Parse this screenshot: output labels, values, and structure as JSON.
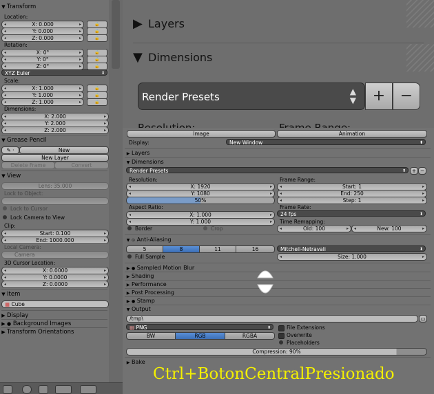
{
  "left_panel": {
    "transform": {
      "title": "Transform",
      "location_label": "Location:",
      "location": [
        "X: 0.000",
        "Y: 0.000",
        "Z: 0.000"
      ],
      "rotation_label": "Rotation:",
      "rotation": [
        "X: 0°",
        "Y: 0°",
        "Z: 0°"
      ],
      "rotation_mode": "XYZ Euler",
      "scale_label": "Scale:",
      "scale": [
        "X: 1.000",
        "Y: 1.000",
        "Z: 1.000"
      ],
      "dimensions_label": "Dimensions:",
      "dimensions": [
        "X: 2.000",
        "Y: 2.000",
        "Z: 2.000"
      ]
    },
    "grease_pencil": {
      "title": "Grease Pencil",
      "new_label": "New",
      "new_layer_label": "New Layer",
      "delete_frame_label": "Delete Frame",
      "convert_label": "Convert"
    },
    "view": {
      "title": "View",
      "lens": "Lens: 35.000",
      "lock_to_object": "Lock to Object:",
      "lock_to_cursor": "Lock to Cursor",
      "lock_camera": "Lock Camera to View",
      "clip_label": "Clip:",
      "clip_start": "Start: 0.100",
      "clip_end": "End: 1000.000",
      "local_camera": "Local Camera:",
      "camera": "Camera",
      "cursor_label": "3D Cursor Location:",
      "cursor": [
        "X: 0.0000",
        "Y: 0.0000",
        "Z: 0.0000"
      ]
    },
    "item": {
      "title": "Item",
      "name": "Cube"
    },
    "collapsed": [
      "Display",
      "Background Images",
      "Transform Orientations"
    ]
  },
  "zoom_overlay": {
    "layers": "Layers",
    "dimensions": "Dimensions",
    "render_presets": "Render Presets",
    "add": "+",
    "remove": "−",
    "peek_resolution": "Resolution:",
    "peek_frame_range": "Frame Range:"
  },
  "properties": {
    "top_buttons": [
      "Image",
      "Animation"
    ],
    "display_label": "Display:",
    "display_value": "New Window",
    "layers": "Layers",
    "dimensions": "Dimensions",
    "render_presets": "Render Presets",
    "resolution_label": "Resolution:",
    "res_x": "X: 1920",
    "res_y": "Y: 1080",
    "res_pct": "50%",
    "frame_range_label": "Frame Range:",
    "start": "Start: 1",
    "end": "End: 250",
    "step": "Step: 1",
    "aspect_label": "Aspect Ratio:",
    "aspect_x": "X: 1.000",
    "aspect_y": "Y: 1.000",
    "frame_rate_label": "Frame Rate:",
    "frame_rate": "24 fps",
    "time_remap_label": "Time Remapping:",
    "old": "Old: 100",
    "new": "New: 100",
    "border": "Border",
    "crop": "Crop",
    "anti_aliasing": "Anti-Aliasing",
    "aa_samples": [
      "5",
      "8",
      "11",
      "16"
    ],
    "aa_selected": "8",
    "aa_filter": "Mitchell-Netravali",
    "full_sample": "Full Sample",
    "size": "Size: 1.000",
    "collapsed": [
      "Sampled Motion Blur",
      "Shading",
      "Performance",
      "Post Processing",
      "Stamp"
    ],
    "output": "Output",
    "output_path": "/tmp\\",
    "format": "PNG",
    "color_modes": [
      "BW",
      "RGB",
      "RGBA"
    ],
    "color_selected": "RGB",
    "file_extensions": "File Extensions",
    "overwrite": "Overwrite",
    "placeholders": "Placeholders",
    "compression": "Compression: 90%",
    "compression_value": 0.9,
    "bake": "Bake"
  },
  "caption": "Ctrl+BotonCentralPresionado",
  "colors": {
    "caption": "#f4f000",
    "selected": "#4a7fc6",
    "dark_field": "#4a4a4a"
  }
}
